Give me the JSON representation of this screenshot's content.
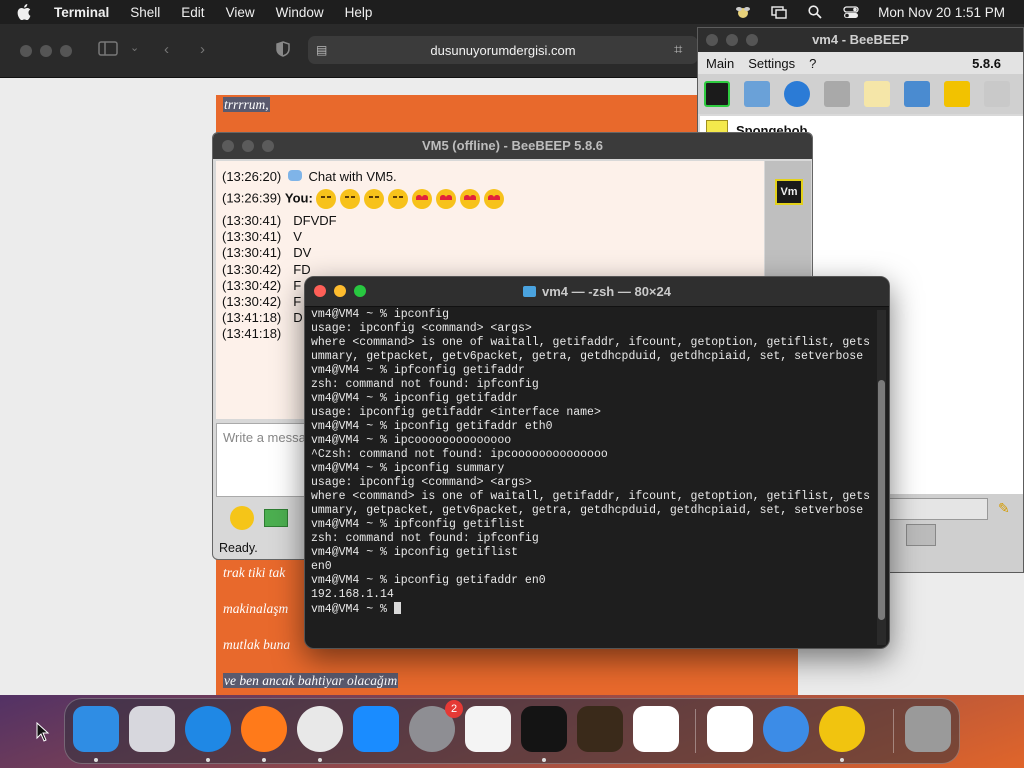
{
  "menubar": {
    "app": "Terminal",
    "items": [
      "Shell",
      "Edit",
      "View",
      "Window",
      "Help"
    ],
    "datetime": "Mon Nov 20  1:51 PM"
  },
  "safari": {
    "url": "dusunuyorumdergisi.com"
  },
  "article": {
    "lines": [
      "trrrrum,",
      "trak tiki tak",
      "makinalaşm",
      "mutlak buna",
      "ve ben ancak bahtiyar olacağım"
    ]
  },
  "beebeep": {
    "title": "vm4 - BeeBEEP",
    "menu": [
      "Main",
      "Settings",
      "?"
    ],
    "version": "5.8.6",
    "contact": "Spongebob",
    "avatar_label": "Vm"
  },
  "vm5": {
    "title": "VM5 (offline) - BeeBEEP 5.8.6",
    "chat_header_time": "(13:26:20)",
    "chat_header_text": "Chat with VM5.",
    "you_time": "(13:26:39)",
    "you_label": "You:",
    "messages": [
      {
        "time": "(13:30:41)",
        "text": "DFVDF"
      },
      {
        "time": "(13:30:41)",
        "text": "V"
      },
      {
        "time": "(13:30:41)",
        "text": "DV"
      },
      {
        "time": "(13:30:42)",
        "text": "FD"
      },
      {
        "time": "(13:30:42)",
        "text": "F"
      },
      {
        "time": "(13:30:42)",
        "text": "F"
      },
      {
        "time": "(13:41:18)",
        "text": "D"
      },
      {
        "time": "(13:41:18)",
        "text": ""
      }
    ],
    "input_placeholder": "Write a messa",
    "status": "Ready."
  },
  "terminal": {
    "title": "vm4 — -zsh — 80×24",
    "lines": [
      "vm4@VM4 ~ % ipconfig",
      "usage: ipconfig <command> <args>",
      "where <command> is one of waitall, getifaddr, ifcount, getoption, getiflist, getsummary, getpacket, getv6packet, getra, getdhcpduid, getdhcpiaid, set, setverbose",
      "vm4@VM4 ~ % ipfconfig getifaddr",
      "zsh: command not found: ipfconfig",
      "vm4@VM4 ~ % ipconfig getifaddr",
      "usage: ipconfig getifaddr <interface name>",
      "vm4@VM4 ~ % ipconfig getifaddr eth0",
      "vm4@VM4 ~ % ipcoooooooooooooo",
      "^Czsh: command not found: ipcoooooooooooooo",
      "vm4@VM4 ~ % ipconfig summary",
      "usage: ipconfig <command> <args>",
      "where <command> is one of waitall, getifaddr, ifcount, getoption, getiflist, getsummary, getpacket, getv6packet, getra, getdhcpduid, getdhcpiaid, set, setverbose",
      "vm4@VM4 ~ % ipfconfig getiflist",
      "zsh: command not found: ipfconfig",
      "vm4@VM4 ~ % ipconfig getiflist",
      "en0",
      "vm4@VM4 ~ % ipconfig getifaddr en0",
      "192.168.1.14",
      "vm4@VM4 ~ % "
    ]
  },
  "dock": {
    "apps": [
      {
        "name": "finder",
        "color": "#2f8de4",
        "running": true
      },
      {
        "name": "launchpad",
        "color": "#d7d7dd",
        "running": false
      },
      {
        "name": "safari",
        "color": "#1f88e5",
        "running": true
      },
      {
        "name": "firefox",
        "color": "#ff7a1a",
        "running": true
      },
      {
        "name": "chrome",
        "color": "#e8e8e8",
        "running": true
      },
      {
        "name": "app-store",
        "color": "#1a8cff",
        "running": false
      },
      {
        "name": "system-settings",
        "color": "#8e8e93",
        "running": false,
        "badge": "2"
      },
      {
        "name": "textedit",
        "color": "#f4f4f4",
        "running": false
      },
      {
        "name": "terminal",
        "color": "#141414",
        "running": true
      },
      {
        "name": "garageband",
        "color": "#3a2a1a",
        "running": false
      },
      {
        "name": "vscode",
        "color": "#ffffff",
        "running": false
      },
      {
        "name": "visual-studio",
        "color": "#ffffff",
        "running": false
      },
      {
        "name": "weather",
        "color": "#3c8ce7",
        "running": false
      },
      {
        "name": "beebeep",
        "color": "#f1c40f",
        "running": true
      },
      {
        "name": "trash",
        "color": "#9a9a9a",
        "running": false
      }
    ]
  }
}
